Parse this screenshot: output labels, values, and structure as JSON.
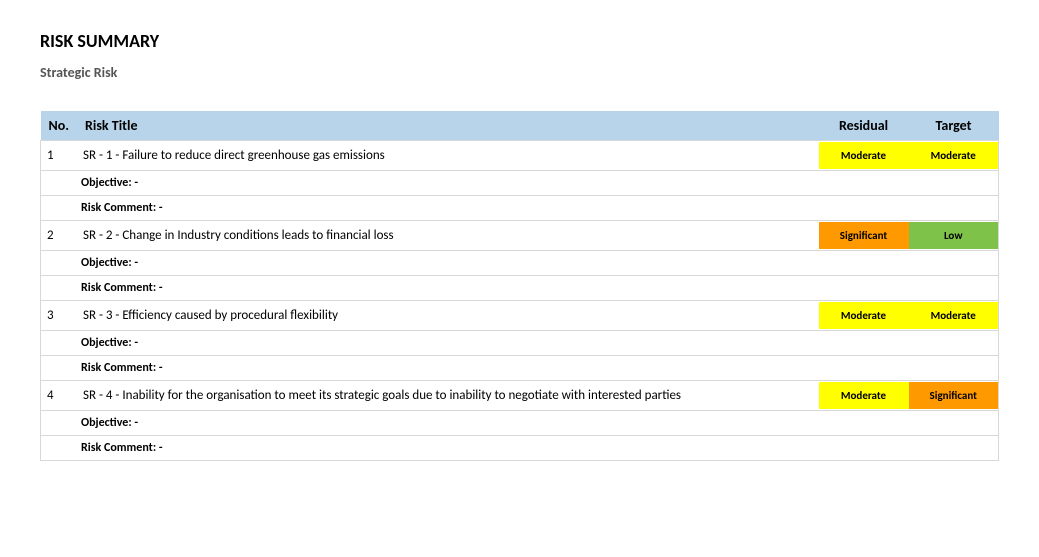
{
  "title": "RISK SUMMARY",
  "subtitle": "Strategic Risk",
  "columns": {
    "no": "No.",
    "risk_title": "Risk Title",
    "residual": "Residual",
    "target": "Target"
  },
  "labels": {
    "objective": "Objective: -",
    "risk_comment": "Risk Comment: -"
  },
  "risks": [
    {
      "no": "1",
      "title": "SR - 1 - Failure to reduce direct greenhouse gas emissions",
      "residual": "Moderate",
      "residual_class": "moderate",
      "target": "Moderate",
      "target_class": "moderate"
    },
    {
      "no": "2",
      "title": "SR - 2 - Change in Industry conditions leads to financial loss",
      "residual": "Significant",
      "residual_class": "significant",
      "target": "Low",
      "target_class": "low"
    },
    {
      "no": "3",
      "title": "SR - 3 - Efficiency caused by procedural flexibility",
      "residual": "Moderate",
      "residual_class": "moderate",
      "target": "Moderate",
      "target_class": "moderate"
    },
    {
      "no": "4",
      "title": "SR - 4 - Inability for the organisation to meet its strategic goals due to inability to negotiate with interested parties",
      "residual": "Moderate",
      "residual_class": "moderate",
      "target": "Significant",
      "target_class": "significant"
    }
  ]
}
